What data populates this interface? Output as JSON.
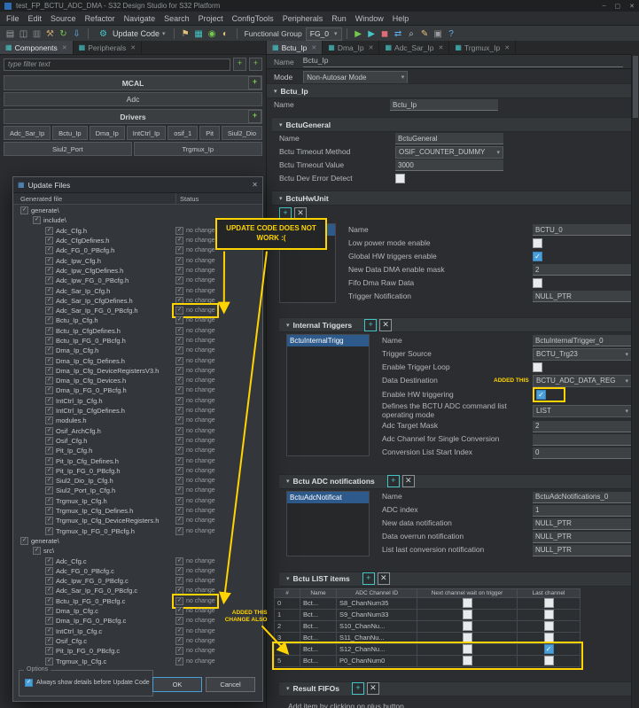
{
  "window": {
    "title": "test_FP_BCTU_ADC_DMA - S32 Design Studio for S32 Platform"
  },
  "menu": {
    "items": [
      "File",
      "Edit",
      "Source",
      "Refactor",
      "Navigate",
      "Search",
      "Project",
      "ConfigTools",
      "Peripherals",
      "Run",
      "Window",
      "Help"
    ]
  },
  "toolbar": {
    "left_icons": [
      {
        "name": "new-file-icon",
        "glyph": "▤",
        "color": "#9a9ea1"
      },
      {
        "name": "save-icon",
        "glyph": "◫",
        "color": "#9a9ea1"
      },
      {
        "name": "save-all-icon",
        "glyph": "▥",
        "color": "#7f8486"
      },
      {
        "name": "build-icon",
        "glyph": "⚒",
        "color": "#c9a26d"
      },
      {
        "name": "refresh-icon",
        "glyph": "↻",
        "color": "#77c94d"
      },
      {
        "name": "import-icon",
        "glyph": "⇩",
        "color": "#61afef"
      }
    ],
    "update_code": {
      "label": "Update Code"
    },
    "mid_icons": [
      {
        "name": "pin-icon",
        "glyph": "⚑",
        "color": "#e5c07b"
      },
      {
        "name": "peripherals-icon",
        "glyph": "▦",
        "color": "#45c6c6"
      },
      {
        "name": "pins-tool-icon",
        "glyph": "◉",
        "color": "#77c94d"
      },
      {
        "name": "clocks-tool-icon",
        "glyph": "◐",
        "color": "#e5c07b"
      }
    ],
    "functional_group": {
      "label": "Functional Group",
      "value": "FG_0"
    },
    "right_icons": [
      {
        "name": "run-icon",
        "glyph": "▶",
        "color": "#77c94d"
      },
      {
        "name": "debug-icon",
        "glyph": "▶",
        "color": "#45c6c6"
      },
      {
        "name": "stop-icon",
        "glyph": "◼",
        "color": "#e06c75"
      },
      {
        "name": "step-icon",
        "glyph": "⇄",
        "color": "#61afef"
      },
      {
        "name": "search-icon",
        "glyph": "⌕",
        "color": "#c7cacc"
      },
      {
        "name": "annotate-icon",
        "glyph": "✎",
        "color": "#e5c07b"
      },
      {
        "name": "terminal-icon",
        "glyph": "▣",
        "color": "#9a9ea1"
      },
      {
        "name": "help-icon",
        "glyph": "?",
        "color": "#61afef"
      }
    ]
  },
  "left_panel": {
    "tabs": [
      {
        "label": "Components",
        "active": true
      },
      {
        "label": "Peripherals",
        "active": false
      }
    ],
    "filter_placeholder": "type filter text",
    "mcal": {
      "title": "MCAL",
      "items": [
        "Adc"
      ]
    },
    "drivers": {
      "title": "Drivers",
      "items": [
        "Adc_Sar_Ip",
        "Bctu_Ip",
        "Dma_Ip",
        "IntCtrl_Ip",
        "osif_1",
        "Pit",
        "Siul2_Dio",
        "Siul2_Port",
        "Trgmux_Ip"
      ]
    }
  },
  "dialog": {
    "title": "Update Files",
    "columns": [
      "Generated file",
      "Status"
    ],
    "rows": [
      {
        "label": "generate\\",
        "level": 0,
        "folder": true
      },
      {
        "label": "include\\",
        "level": 1,
        "folder": true
      },
      {
        "label": "Adc_Cfg.h",
        "level": 2,
        "status": "no change"
      },
      {
        "label": "Adc_CfgDefines.h",
        "level": 2,
        "status": "no change"
      },
      {
        "label": "Adc_FG_0_PBcfg.h",
        "level": 2,
        "status": "no change"
      },
      {
        "label": "Adc_Ipw_Cfg.h",
        "level": 2,
        "status": "no change"
      },
      {
        "label": "Adc_Ipw_CfgDefines.h",
        "level": 2,
        "status": "no change"
      },
      {
        "label": "Adc_Ipw_FG_0_PBcfg.h",
        "level": 2,
        "status": "no change"
      },
      {
        "label": "Adc_Sar_Ip_Cfg.h",
        "level": 2,
        "status": "no change"
      },
      {
        "label": "Adc_Sar_Ip_CfgDefines.h",
        "level": 2,
        "status": "no change"
      },
      {
        "label": "Adc_Sar_Ip_FG_0_PBcfg.h",
        "level": 2,
        "status": "no change",
        "highlight": true
      },
      {
        "label": "Bctu_Ip_Cfg.h",
        "level": 2,
        "status": "no change"
      },
      {
        "label": "Bctu_Ip_CfgDefines.h",
        "level": 2,
        "status": "no change"
      },
      {
        "label": "Bctu_Ip_FG_0_PBcfg.h",
        "level": 2,
        "status": "no change"
      },
      {
        "label": "Dma_Ip_Cfg.h",
        "level": 2,
        "status": "no change"
      },
      {
        "label": "Dma_Ip_Cfg_Defines.h",
        "level": 2,
        "status": "no change"
      },
      {
        "label": "Dma_Ip_Cfg_DeviceRegistersV3.h",
        "level": 2,
        "status": "no change"
      },
      {
        "label": "Dma_Ip_Cfg_Devices.h",
        "level": 2,
        "status": "no change"
      },
      {
        "label": "Dma_Ip_FG_0_PBcfg.h",
        "level": 2,
        "status": "no change"
      },
      {
        "label": "IntCtrl_Ip_Cfg.h",
        "level": 2,
        "status": "no change"
      },
      {
        "label": "IntCtrl_Ip_CfgDefines.h",
        "level": 2,
        "status": "no change"
      },
      {
        "label": "modules.h",
        "level": 2,
        "status": "no change"
      },
      {
        "label": "Osif_ArchCfg.h",
        "level": 2,
        "status": "no change"
      },
      {
        "label": "Osif_Cfg.h",
        "level": 2,
        "status": "no change"
      },
      {
        "label": "Pit_Ip_Cfg.h",
        "level": 2,
        "status": "no change"
      },
      {
        "label": "Pit_Ip_Cfg_Defines.h",
        "level": 2,
        "status": "no change"
      },
      {
        "label": "Pit_Ip_FG_0_PBcfg.h",
        "level": 2,
        "status": "no change"
      },
      {
        "label": "Siul2_Dio_Ip_Cfg.h",
        "level": 2,
        "status": "no change"
      },
      {
        "label": "Siul2_Port_Ip_Cfg.h",
        "level": 2,
        "status": "no change"
      },
      {
        "label": "Trgmux_Ip_Cfg.h",
        "level": 2,
        "status": "no change"
      },
      {
        "label": "Trgmux_Ip_Cfg_Defines.h",
        "level": 2,
        "status": "no change"
      },
      {
        "label": "Trgmux_Ip_Cfg_DeviceRegisters.h",
        "level": 2,
        "status": "no change"
      },
      {
        "label": "Trgmux_Ip_FG_0_PBcfg.h",
        "level": 2,
        "status": "no change"
      },
      {
        "label": "generate\\",
        "level": 0,
        "folder": true
      },
      {
        "label": "src\\",
        "level": 1,
        "folder": true
      },
      {
        "label": "Adc_Cfg.c",
        "level": 2,
        "status": "no change"
      },
      {
        "label": "Adc_FG_0_PBcfg.c",
        "level": 2,
        "status": "no change"
      },
      {
        "label": "Adc_Ipw_FG_0_PBcfg.c",
        "level": 2,
        "status": "no change"
      },
      {
        "label": "Adc_Sar_Ip_FG_0_PBcfg.c",
        "level": 2,
        "status": "no change"
      },
      {
        "label": "Bctu_Ip_FG_0_PBcfg.c",
        "level": 2,
        "status": "no change",
        "highlight": true
      },
      {
        "label": "Dma_Ip_Cfg.c",
        "level": 2,
        "status": "no change"
      },
      {
        "label": "Dma_Ip_FG_0_PBcfg.c",
        "level": 2,
        "status": "no change"
      },
      {
        "label": "IntCtrl_Ip_Cfg.c",
        "level": 2,
        "status": "no change"
      },
      {
        "label": "Osif_Cfg.c",
        "level": 2,
        "status": "no change"
      },
      {
        "label": "Pit_Ip_FG_0_PBcfg.c",
        "level": 2,
        "status": "no change"
      },
      {
        "label": "Trgmux_Ip_Cfg.c",
        "level": 2,
        "status": "no change"
      }
    ],
    "options": {
      "group_label": "Options",
      "checkbox_label": "Always show details before Update Code",
      "checked": true
    },
    "buttons": {
      "ok": "OK",
      "cancel": "Cancel"
    }
  },
  "editor": {
    "tabs": [
      {
        "label": "Bctu_Ip",
        "active": true
      },
      {
        "label": "Dma_Ip"
      },
      {
        "label": "Adc_Sar_Ip"
      },
      {
        "label": "Trgmux_Ip"
      }
    ],
    "name_label": "Name",
    "name_value": "Bctu_Ip",
    "mode_label": "Mode",
    "mode_value": "Non-Autosar Mode",
    "sections": {
      "bctu": {
        "title": "Bctu_Ip",
        "fields": [
          {
            "label": "Name",
            "type": "text",
            "value": "Bctu_Ip"
          }
        ]
      },
      "general": {
        "title": "BctuGeneral",
        "fields": [
          {
            "label": "Name",
            "type": "text",
            "value": "BctuGeneral"
          },
          {
            "label": "Bctu Timeout Method",
            "type": "select",
            "value": "OSIF_COUNTER_DUMMY"
          },
          {
            "label": "Bctu Timeout Value",
            "type": "text",
            "value": "3000"
          },
          {
            "label": "Bctu Dev Error Detect",
            "type": "checkbox",
            "checked": false
          }
        ]
      },
      "hwunit": {
        "title": "BctuHwUnit",
        "list": [
          {
            "label": "0",
            "selected": true
          }
        ],
        "fields": [
          {
            "label": "Name",
            "type": "text",
            "value": "BCTU_0"
          },
          {
            "label": "Low power mode enable",
            "type": "checkbox",
            "checked": false
          },
          {
            "label": "Global HW triggers enable",
            "type": "checkbox",
            "checked": true
          },
          {
            "label": "New Data DMA enable mask",
            "type": "text",
            "value": "2"
          },
          {
            "label": "Fifo Dma Raw Data",
            "type": "checkbox",
            "checked": false
          },
          {
            "label": "Trigger Notification",
            "type": "text",
            "value": "NULL_PTR"
          }
        ]
      },
      "triggers": {
        "title": "Internal Triggers",
        "list": [
          {
            "label": "BctuInternalTrigg",
            "selected": true
          }
        ],
        "fields": [
          {
            "label": "Name",
            "type": "text",
            "value": "BctuInternalTrigger_0"
          },
          {
            "label": "Trigger Source",
            "type": "select",
            "value": "BCTU_Trg23"
          },
          {
            "label": "Enable Trigger Loop",
            "type": "checkbox",
            "checked": false
          },
          {
            "label": "Data Destination",
            "type": "select",
            "value": "BCTU_ADC_DATA_REG"
          },
          {
            "label": "Enable HW triggering",
            "type": "checkbox",
            "checked": true,
            "highlight": true
          },
          {
            "label": "Defines the BCTU ADC command list operating mode",
            "type": "select",
            "value": "LIST"
          },
          {
            "label": "Adc Target Mask",
            "type": "text",
            "value": "2"
          },
          {
            "label": "Adc Channel for Single Conversion",
            "type": "text",
            "value": ""
          },
          {
            "label": "Conversion List Start Index",
            "type": "text",
            "value": "0"
          }
        ]
      },
      "notifications": {
        "title": "Bctu ADC notifications",
        "list": [
          {
            "label": "BctuAdcNotificat",
            "selected": true
          }
        ],
        "fields": [
          {
            "label": "Name",
            "type": "text",
            "value": "BctuAdcNotifications_0"
          },
          {
            "label": "ADC index",
            "type": "text",
            "value": "1"
          },
          {
            "label": "New data notification",
            "type": "text",
            "value": "NULL_PTR"
          },
          {
            "label": "Data overrun notification",
            "type": "text",
            "value": "NULL_PTR"
          },
          {
            "label": "List last conversion notification",
            "type": "text",
            "value": "NULL_PTR"
          }
        ]
      },
      "list_items": {
        "title": "Bctu LIST items",
        "columns": [
          "#",
          "Name",
          "ADC Channel ID",
          "Next channel wait on trigger",
          "Last channel"
        ],
        "rows": [
          {
            "num": "0",
            "name": "Bct...",
            "channel": "S8_ChanNum35",
            "wait": false,
            "last": false
          },
          {
            "num": "1",
            "name": "Bct...",
            "channel": "S9_ChanNum33",
            "wait": false,
            "last": false
          },
          {
            "num": "2",
            "name": "Bct...",
            "channel": "S10_ChanNu...",
            "wait": false,
            "last": false
          },
          {
            "num": "3",
            "name": "Bct...",
            "channel": "S11_ChanNu...",
            "wait": false,
            "last": false
          },
          {
            "num": "4",
            "name": "Bct...",
            "channel": "S12_ChanNu...",
            "wait": false,
            "last": true,
            "highlight": true
          },
          {
            "num": "5",
            "name": "Bct...",
            "channel": "P0_ChanNum0",
            "wait": false,
            "last": false,
            "highlight": true
          }
        ]
      },
      "fifos": {
        "title": "Result FIFOs",
        "empty_text": "Add item by clicking on plus button"
      }
    }
  },
  "annotations": {
    "update_note": "UPDATE CODE DOES NOT WORK :(",
    "added_this": "ADDED THIS",
    "added_change": "ADDED THIS CHANGE ALSO"
  }
}
